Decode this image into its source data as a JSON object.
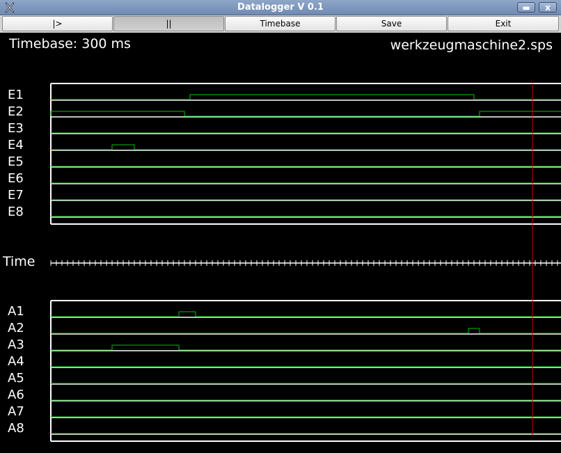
{
  "window": {
    "title": "Datalogger  V 0.1",
    "minimize_glyph": "▬",
    "close_glyph": "x",
    "app_icon": "x-icon"
  },
  "toolbar": {
    "play_label": "|>",
    "pause_label": "||",
    "timebase_label": "Timebase",
    "save_label": "Save",
    "exit_label": "Exit"
  },
  "header": {
    "timebase_text": "Timebase: 300 ms",
    "filename": "werkzeugmaschine2.sps"
  },
  "time_label": "Time",
  "colors": {
    "signal": "#00c000",
    "frame": "#ffffff",
    "cursor": "#cc0000",
    "background": "#000000"
  },
  "chart_data": [
    {
      "type": "timing",
      "group": "inputs",
      "channels": [
        "E1",
        "E2",
        "E3",
        "E4",
        "E5",
        "E6",
        "E7",
        "E8"
      ],
      "high_intervals_ticks": {
        "E1": [
          [
            25,
            76
          ]
        ],
        "E2": [
          [
            0,
            24
          ],
          [
            77,
            92
          ]
        ],
        "E3": [],
        "E4": [
          [
            11,
            15
          ]
        ],
        "E5": [],
        "E6": [],
        "E7": [],
        "E8": []
      }
    },
    {
      "type": "timing",
      "group": "outputs",
      "channels": [
        "A1",
        "A2",
        "A3",
        "A4",
        "A5",
        "A6",
        "A7",
        "A8"
      ],
      "high_intervals_ticks": {
        "A1": [
          [
            23,
            26
          ]
        ],
        "A2": [
          [
            75,
            77
          ]
        ],
        "A3": [
          [
            11,
            23
          ]
        ],
        "A4": [],
        "A5": [],
        "A6": [],
        "A7": [],
        "A8": []
      }
    }
  ],
  "time_axis": {
    "ticks_visible": 92,
    "cursor_tick": 86.5
  }
}
